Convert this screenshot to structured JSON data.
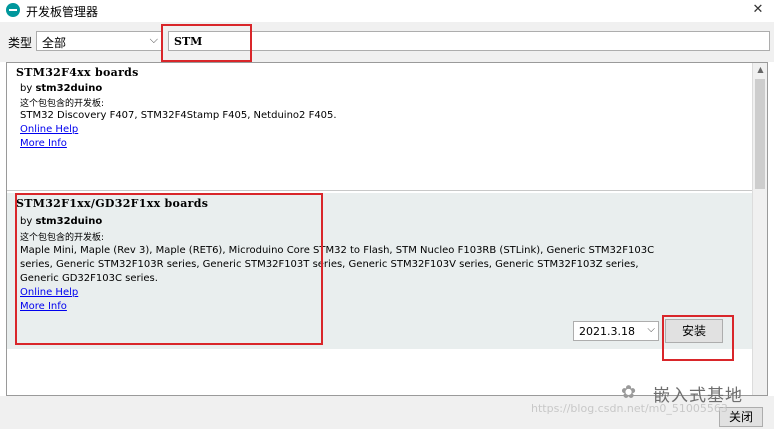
{
  "window": {
    "title": "开发板管理器",
    "close_glyph": "✕"
  },
  "filter": {
    "type_label": "类型",
    "type_value": "全部",
    "search_value": "STM"
  },
  "boards": [
    {
      "title": "STM32F4xx boards",
      "by_prefix": "by",
      "author": "stm32duino",
      "includes_label": "这个包包含的开发板:",
      "description": "STM32 Discovery F407, STM32F4Stamp F405, Netduino2 F405.",
      "online_help": "Online Help",
      "more_info": "More Info"
    },
    {
      "title": "STM32F1xx/GD32F1xx boards",
      "by_prefix": "by",
      "author": "stm32duino",
      "includes_label": "这个包包含的开发板:",
      "description_lines": [
        "Maple Mini, Maple (Rev 3), Maple (RET6), Microduino Core STM32 to Flash, STM Nucleo F103RB (STLink), Generic STM32F103C",
        "series, Generic STM32F103R series, Generic STM32F103T series, Generic STM32F103V series, Generic STM32F103Z series,",
        "Generic GD32F103C series."
      ],
      "online_help": "Online Help",
      "more_info": "More Info",
      "version": "2021.3.18",
      "install_label": "安装"
    }
  ],
  "footer": {
    "close_label": "关闭"
  },
  "watermark": {
    "name": "嵌入式基地",
    "url": "https://blog.csdn.net/m0_51005563"
  },
  "colors": {
    "highlight": "#d9262a",
    "link": "#0000ee",
    "selected_row": "#e9eeee",
    "arduino_teal": "#00979c"
  }
}
